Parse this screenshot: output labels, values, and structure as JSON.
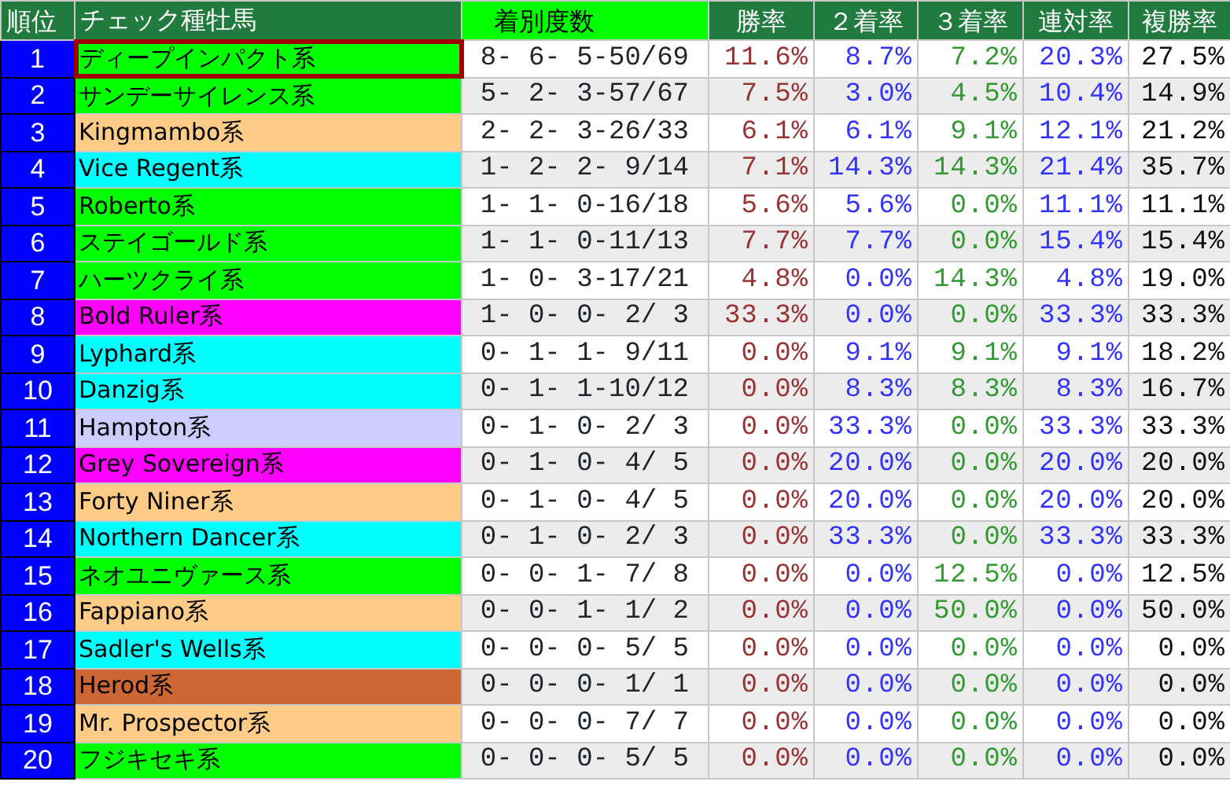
{
  "table": {
    "columns": [
      "順位",
      "チェック種牡馬",
      "着別度数",
      "勝率",
      "２着率",
      "３着率",
      "連対率",
      "複勝率"
    ],
    "rows": [
      {
        "rank": "1",
        "name": "ディープインパクト系",
        "color": "#00ff00",
        "selected": true,
        "record": "8- 6- 5-50/69",
        "win": "11.6%",
        "second": "8.7%",
        "third": "7.2%",
        "top2": "20.3%",
        "top3": "27.5%"
      },
      {
        "rank": "2",
        "name": "サンデーサイレンス系",
        "color": "#00ff00",
        "selected": false,
        "record": "5- 2- 3-57/67",
        "win": "7.5%",
        "second": "3.0%",
        "third": "4.5%",
        "top2": "10.4%",
        "top3": "14.9%"
      },
      {
        "rank": "3",
        "name": "Kingmambo系",
        "color": "#ffcc88",
        "selected": false,
        "record": "2- 2- 3-26/33",
        "win": "6.1%",
        "second": "6.1%",
        "third": "9.1%",
        "top2": "12.1%",
        "top3": "21.2%"
      },
      {
        "rank": "4",
        "name": "Vice Regent系",
        "color": "#00ffff",
        "selected": false,
        "record": "1- 2- 2- 9/14",
        "win": "7.1%",
        "second": "14.3%",
        "third": "14.3%",
        "top2": "21.4%",
        "top3": "35.7%"
      },
      {
        "rank": "5",
        "name": "Roberto系",
        "color": "#00ff00",
        "selected": false,
        "record": "1- 1- 0-16/18",
        "win": "5.6%",
        "second": "5.6%",
        "third": "0.0%",
        "top2": "11.1%",
        "top3": "11.1%"
      },
      {
        "rank": "6",
        "name": "ステイゴールド系",
        "color": "#00ff00",
        "selected": false,
        "record": "1- 1- 0-11/13",
        "win": "7.7%",
        "second": "7.7%",
        "third": "0.0%",
        "top2": "15.4%",
        "top3": "15.4%"
      },
      {
        "rank": "7",
        "name": "ハーツクライ系",
        "color": "#00ff00",
        "selected": false,
        "record": "1- 0- 3-17/21",
        "win": "4.8%",
        "second": "0.0%",
        "third": "14.3%",
        "top2": "4.8%",
        "top3": "19.0%"
      },
      {
        "rank": "8",
        "name": "Bold Ruler系",
        "color": "#ff00ff",
        "selected": false,
        "record": "1- 0- 0- 2/ 3",
        "win": "33.3%",
        "second": "0.0%",
        "third": "0.0%",
        "top2": "33.3%",
        "top3": "33.3%"
      },
      {
        "rank": "9",
        "name": "Lyphard系",
        "color": "#00ffff",
        "selected": false,
        "record": "0- 1- 1- 9/11",
        "win": "0.0%",
        "second": "9.1%",
        "third": "9.1%",
        "top2": "9.1%",
        "top3": "18.2%"
      },
      {
        "rank": "10",
        "name": "Danzig系",
        "color": "#00ffff",
        "selected": false,
        "record": "0- 1- 1-10/12",
        "win": "0.0%",
        "second": "8.3%",
        "third": "8.3%",
        "top2": "8.3%",
        "top3": "16.7%"
      },
      {
        "rank": "11",
        "name": "Hampton系",
        "color": "#ccccff",
        "selected": false,
        "record": "0- 1- 0- 2/ 3",
        "win": "0.0%",
        "second": "33.3%",
        "third": "0.0%",
        "top2": "33.3%",
        "top3": "33.3%"
      },
      {
        "rank": "12",
        "name": "Grey Sovereign系",
        "color": "#ff00ff",
        "selected": false,
        "record": "0- 1- 0- 4/ 5",
        "win": "0.0%",
        "second": "20.0%",
        "third": "0.0%",
        "top2": "20.0%",
        "top3": "20.0%"
      },
      {
        "rank": "13",
        "name": "Forty Niner系",
        "color": "#ffcc88",
        "selected": false,
        "record": "0- 1- 0- 4/ 5",
        "win": "0.0%",
        "second": "20.0%",
        "third": "0.0%",
        "top2": "20.0%",
        "top3": "20.0%"
      },
      {
        "rank": "14",
        "name": "Northern Dancer系",
        "color": "#00ffff",
        "selected": false,
        "record": "0- 1- 0- 2/ 3",
        "win": "0.0%",
        "second": "33.3%",
        "third": "0.0%",
        "top2": "33.3%",
        "top3": "33.3%"
      },
      {
        "rank": "15",
        "name": "ネオユニヴァース系",
        "color": "#00ff00",
        "selected": false,
        "record": "0- 0- 1- 7/ 8",
        "win": "0.0%",
        "second": "0.0%",
        "third": "12.5%",
        "top2": "0.0%",
        "top3": "12.5%"
      },
      {
        "rank": "16",
        "name": "Fappiano系",
        "color": "#ffcc88",
        "selected": false,
        "record": "0- 0- 1- 1/ 2",
        "win": "0.0%",
        "second": "0.0%",
        "third": "50.0%",
        "top2": "0.0%",
        "top3": "50.0%"
      },
      {
        "rank": "17",
        "name": "Sadler's Wells系",
        "color": "#00ffff",
        "selected": false,
        "record": "0- 0- 0- 5/ 5",
        "win": "0.0%",
        "second": "0.0%",
        "third": "0.0%",
        "top2": "0.0%",
        "top3": "0.0%"
      },
      {
        "rank": "18",
        "name": "Herod系",
        "color": "#cc6633",
        "selected": false,
        "record": "0- 0- 0- 1/ 1",
        "win": "0.0%",
        "second": "0.0%",
        "third": "0.0%",
        "top2": "0.0%",
        "top3": "0.0%"
      },
      {
        "rank": "19",
        "name": "Mr. Prospector系",
        "color": "#ffcc88",
        "selected": false,
        "record": "0- 0- 0- 7/ 7",
        "win": "0.0%",
        "second": "0.0%",
        "third": "0.0%",
        "top2": "0.0%",
        "top3": "0.0%"
      },
      {
        "rank": "20",
        "name": "フジキセキ系",
        "color": "#00ff00",
        "selected": false,
        "record": "0- 0- 0- 5/ 5",
        "win": "0.0%",
        "second": "0.0%",
        "third": "0.0%",
        "top2": "0.0%",
        "top3": "0.0%"
      }
    ]
  }
}
